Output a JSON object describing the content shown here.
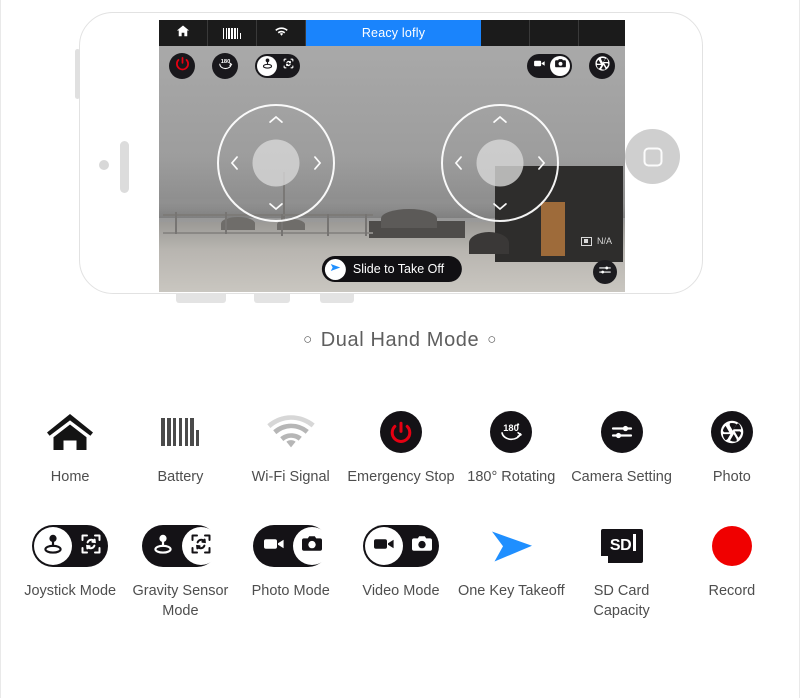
{
  "app": {
    "status_bar": {
      "home_icon": "home-icon",
      "battery_icon": "battery-icon",
      "wifi_icon": "wifi-icon",
      "status_text": "Reacy lofly"
    },
    "controls": {
      "power_icon": "power-icon",
      "rotate_label": "180°",
      "rotate_icon": "rotate-180-icon",
      "joystick_icon": "joystick-icon",
      "gravity_icon": "gravity-sensor-icon",
      "video_icon": "video-camera-icon",
      "photo_icon": "photo-camera-icon",
      "aperture_icon": "aperture-icon",
      "settings_icon": "sliders-icon"
    },
    "joysticks": {
      "left_name": "left-joystick",
      "right_name": "right-joystick",
      "up_icon": "chevron-up-icon",
      "down_icon": "chevron-down-icon",
      "left_icon": "chevron-left-icon",
      "right_icon": "chevron-right-icon"
    },
    "takeoff": {
      "label": "Slide to Take Off",
      "icon": "play-arrow-icon"
    },
    "sd_indicator": {
      "icon": "sd-card-icon",
      "value": "N/A"
    }
  },
  "caption": {
    "dot_left": "○",
    "text": "Dual Hand Mode",
    "dot_right": "○"
  },
  "legend": {
    "row1": [
      {
        "label": "Home",
        "icon": "home-icon"
      },
      {
        "label": "Battery",
        "icon": "battery-icon"
      },
      {
        "label": "Wi-Fi Signal",
        "icon": "wifi-icon"
      },
      {
        "label": "Emergency Stop",
        "icon": "power-icon"
      },
      {
        "label": "180° Rotating",
        "icon": "rotate-180-icon",
        "badge": "180°"
      },
      {
        "label": "Camera Setting",
        "icon": "sliders-icon"
      },
      {
        "label": "Photo",
        "icon": "aperture-icon"
      }
    ],
    "row2": [
      {
        "label": "Joystick Mode",
        "icon": "joystick-gravity-toggle",
        "selected": "left"
      },
      {
        "label": "Gravity Sensor Mode",
        "icon": "joystick-gravity-toggle",
        "selected": "right"
      },
      {
        "label": "Photo Mode",
        "icon": "video-photo-toggle",
        "selected": "right"
      },
      {
        "label": "Video Mode",
        "icon": "video-photo-toggle",
        "selected": "left"
      },
      {
        "label": "One Key Takeoff",
        "icon": "play-arrow-icon"
      },
      {
        "label": "SD Card Capacity",
        "icon": "sd-card-icon",
        "badge": "SD"
      },
      {
        "label": "Record",
        "icon": "record-dot-icon"
      }
    ]
  },
  "colors": {
    "accent_blue": "#1a84fc",
    "danger_red": "#e60012",
    "record_red": "#f00000",
    "takeoff_blue": "#1f8fff",
    "icon_dark": "#141216"
  }
}
